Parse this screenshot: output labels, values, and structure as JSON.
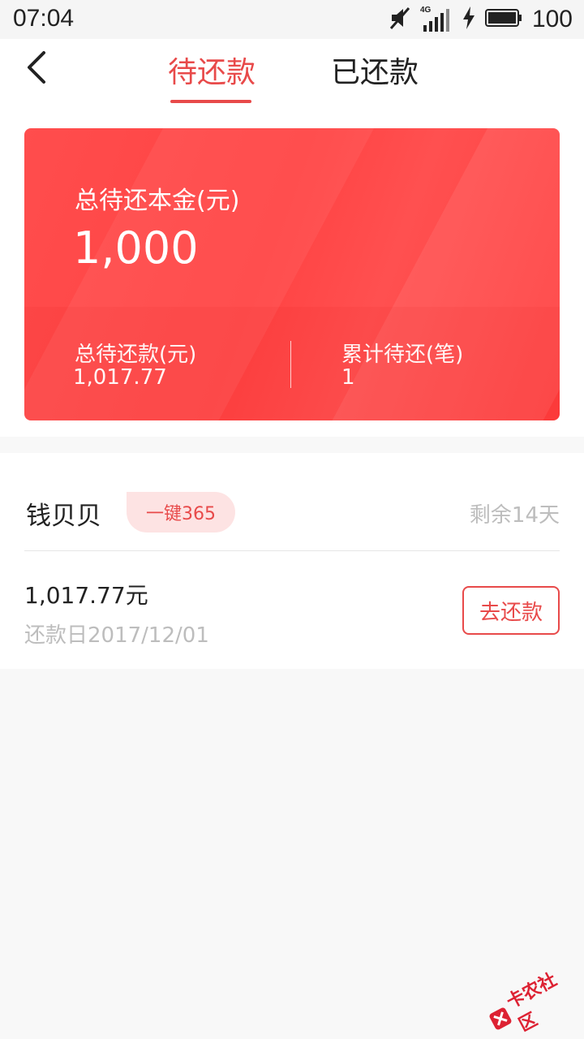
{
  "status_bar": {
    "time": "07:04",
    "network_label": "4G",
    "battery_level": "100",
    "icons": [
      "mute-icon",
      "signal-icon",
      "charging-icon",
      "battery-icon"
    ]
  },
  "nav": {
    "back_icon": "chevron-left-icon",
    "tabs": [
      {
        "label": "待还款",
        "active": true
      },
      {
        "label": "已还款",
        "active": false
      }
    ]
  },
  "summary_card": {
    "principal_label": "总待还本金(元)",
    "principal_value": "1,000",
    "total_label": "总待还款(元)",
    "total_value": "1,017.77",
    "count_label": "累计待还(笔)",
    "count_value": "1"
  },
  "loan_item": {
    "merchant": "钱贝贝",
    "badge": "一键365",
    "remaining": "剩余14天",
    "amount": "1,017.77元",
    "due_date": "还款日2017/12/01",
    "action": "去还款"
  },
  "watermark": {
    "text": "卡农社区",
    "icon": "card-logo-icon"
  },
  "colors": {
    "accent": "#e84a4a",
    "card_red": "#ff4444",
    "muted_text": "#bdbdbd",
    "page_bg": "#f8f8f8"
  }
}
